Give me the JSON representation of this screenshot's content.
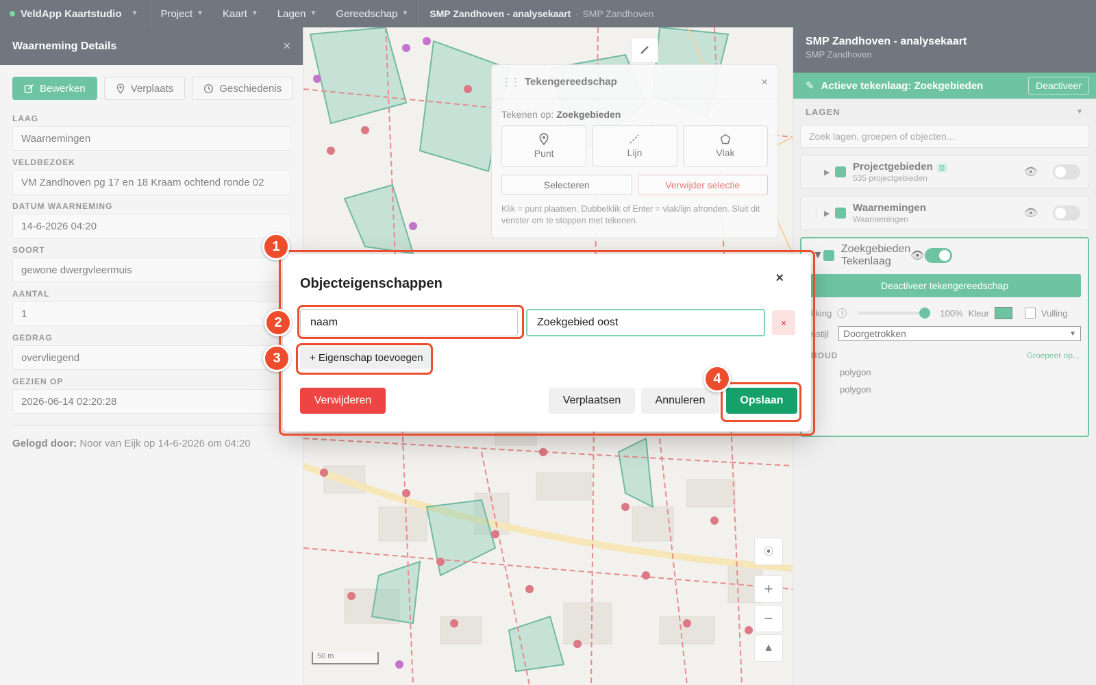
{
  "topbar": {
    "brand": "VeldApp Kaartstudio",
    "menus": [
      "Project",
      "Kaart",
      "Lagen",
      "Gereedschap"
    ],
    "project_title": "SMP Zandhoven - analysekaart",
    "project_sep": "·",
    "project_sub": "SMP Zandhoven"
  },
  "left_panel": {
    "title": "Waarneming Details",
    "close": "×",
    "actions": {
      "edit": "Bewerken",
      "move": "Verplaats",
      "history": "Geschiedenis"
    },
    "fields": [
      {
        "label": "LAAG",
        "value": "Waarnemingen"
      },
      {
        "label": "VELDBEZOEK",
        "value": "VM Zandhoven pg 17 en 18 Kraam ochtend ronde 02"
      },
      {
        "label": "DATUM WAARNEMING",
        "value": "14-6-2026 04:20"
      },
      {
        "label": "SOORT",
        "value": "gewone dwergvleermuis"
      },
      {
        "label": "AANTAL",
        "value": "1"
      },
      {
        "label": "GEDRAG",
        "value": "overvliegend"
      },
      {
        "label": "GEZIEN OP",
        "value": "2026-06-14 02:20:28"
      }
    ],
    "logged_label": "Gelogd door:",
    "logged_value": "Noor van Eijk op 14-6-2026 om 04:20"
  },
  "drawtool": {
    "title": "Tekengereedschap",
    "close": "×",
    "draw_on_label": "Tekenen op:",
    "draw_on_value": "Zoekgebieden",
    "tools": [
      "Punt",
      "Lijn",
      "Vlak"
    ],
    "select": "Selecteren",
    "delete_selection": "Verwijder selectie",
    "help": "Klik = punt plaatsen. Dubbelklik of Enter = vlak/lijn afronden. Sluit dit venster om te stoppen met tekenen."
  },
  "map": {
    "scale": "50 m",
    "zoom_in": "+",
    "zoom_out": "−",
    "north": "▲"
  },
  "right_panel": {
    "title": "SMP Zandhoven - analysekaart",
    "subtitle": "SMP Zandhoven",
    "active_layer": "Actieve tekenlaag: Zoekgebieden",
    "deactivate": "Deactiveer",
    "layers_heading": "LAGEN",
    "search_placeholder": "Zoek lagen, groepen of objecten...",
    "layers": [
      {
        "name": "Projectgebieden",
        "sub": "535 projectgebieden",
        "on": false
      },
      {
        "name": "Waarnemingen",
        "sub": "Waarnemingen",
        "on": false
      },
      {
        "name": "Zoekgebieden",
        "sub": "Tekenlaag",
        "on": true
      }
    ],
    "deactivate_tool": "Deactiveer tekengereedschap",
    "opacity_label": "kking",
    "opacity_value": "100%",
    "color_label": "Kleur",
    "fill_label": "Vulling",
    "style_label": "nstijl",
    "style_value": "Doorgetrokken",
    "content_label": "HOUD",
    "group_by": "Groepeer op...",
    "items": [
      "polygon",
      "polygon"
    ]
  },
  "modal": {
    "title": "Objecteigenschappen",
    "close": "×",
    "key": "naam",
    "value": "Zoekgebied oost",
    "remove": "×",
    "add_property": "+ Eigenschap toevoegen",
    "delete": "Verwijderen",
    "move": "Verplaatsen",
    "cancel": "Annuleren",
    "save": "Opslaan"
  },
  "callouts": [
    "1",
    "2",
    "3",
    "4"
  ],
  "colors": {
    "accent": "#16a06a",
    "danger": "#ef4444",
    "callout": "#ee4d2d",
    "topbar": "#1b2431"
  }
}
